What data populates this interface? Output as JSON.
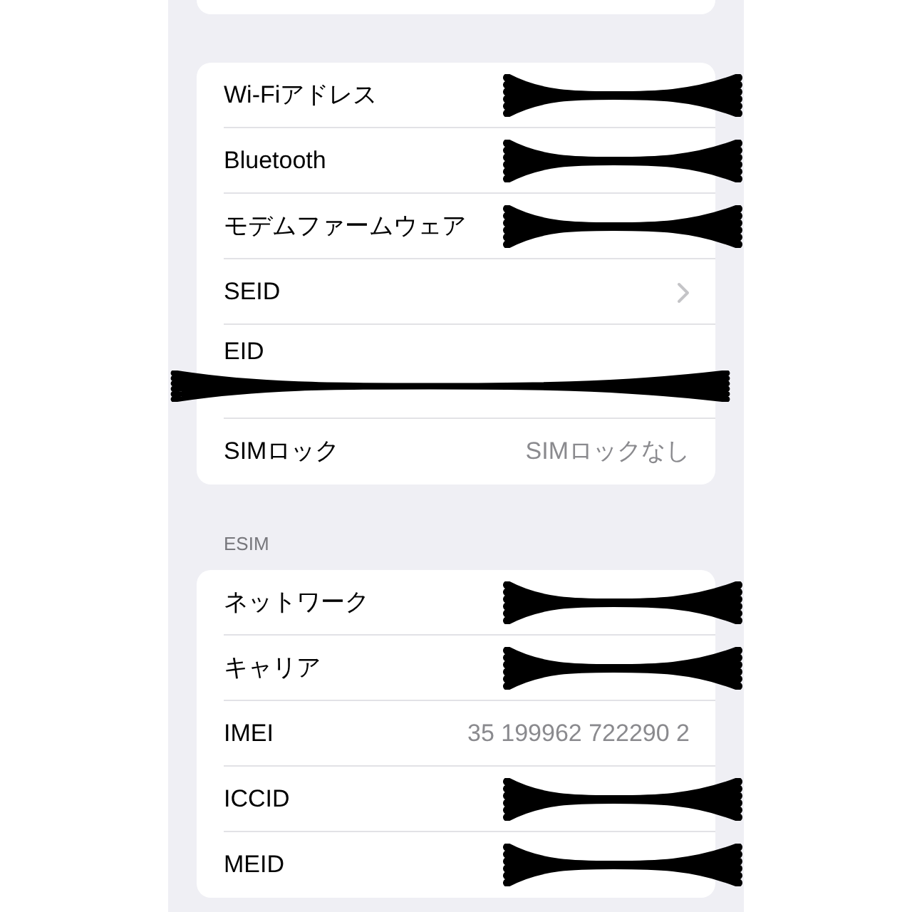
{
  "device_info": {
    "rows": [
      {
        "label": "Wi-Fiアドレス",
        "kind": "plain",
        "redacted": true
      },
      {
        "label": "Bluetooth",
        "kind": "plain",
        "redacted": true
      },
      {
        "label": "モデムファームウェア",
        "kind": "plain",
        "redacted": true
      },
      {
        "label": "SEID",
        "kind": "link",
        "redacted": false
      },
      {
        "label": "EID",
        "kind": "block",
        "redacted": true
      },
      {
        "label": "SIMロック",
        "kind": "plain",
        "value": "SIMロックなし",
        "redacted": false
      }
    ]
  },
  "esim": {
    "header": "ESIM",
    "rows": [
      {
        "label": "ネットワーク",
        "kind": "plain",
        "redacted": true
      },
      {
        "label": "キャリア",
        "kind": "plain",
        "redacted": true
      },
      {
        "label": "IMEI",
        "kind": "plain",
        "value": "35 199962 722290 2",
        "redacted": false
      },
      {
        "label": "ICCID",
        "kind": "plain",
        "redacted": true
      },
      {
        "label": "MEID",
        "kind": "plain",
        "redacted": true
      }
    ]
  }
}
